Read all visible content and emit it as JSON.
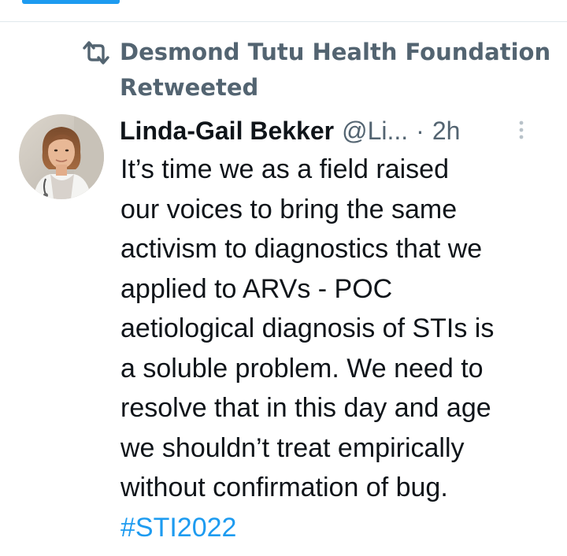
{
  "colors": {
    "accent": "#1d9bf0",
    "secondary_text": "#536471",
    "primary_text": "#0f1419",
    "divider": "#e1e8ed"
  },
  "social_context": {
    "icon": "retweet-icon",
    "line1": "Desmond Tutu Health Foundation",
    "line2": "Retweeted"
  },
  "tweet": {
    "author": {
      "avatar_icon": "avatar",
      "display_name": "Linda-Gail Bekker",
      "handle": "@Li...",
      "separator": "·",
      "time": "2h"
    },
    "more_icon": "more-vertical-icon",
    "text_lines": [
      "It’s time we as a field raised",
      "our voices to bring the same",
      "activism to diagnostics that we",
      "applied to ARVs - POC",
      "aetiological diagnosis of STIs is",
      "a soluble problem. We need to",
      "resolve that in this day and age",
      "we shouldn’t treat empirically",
      "without confirmation of bug."
    ],
    "hashtag": "#STI2022"
  }
}
